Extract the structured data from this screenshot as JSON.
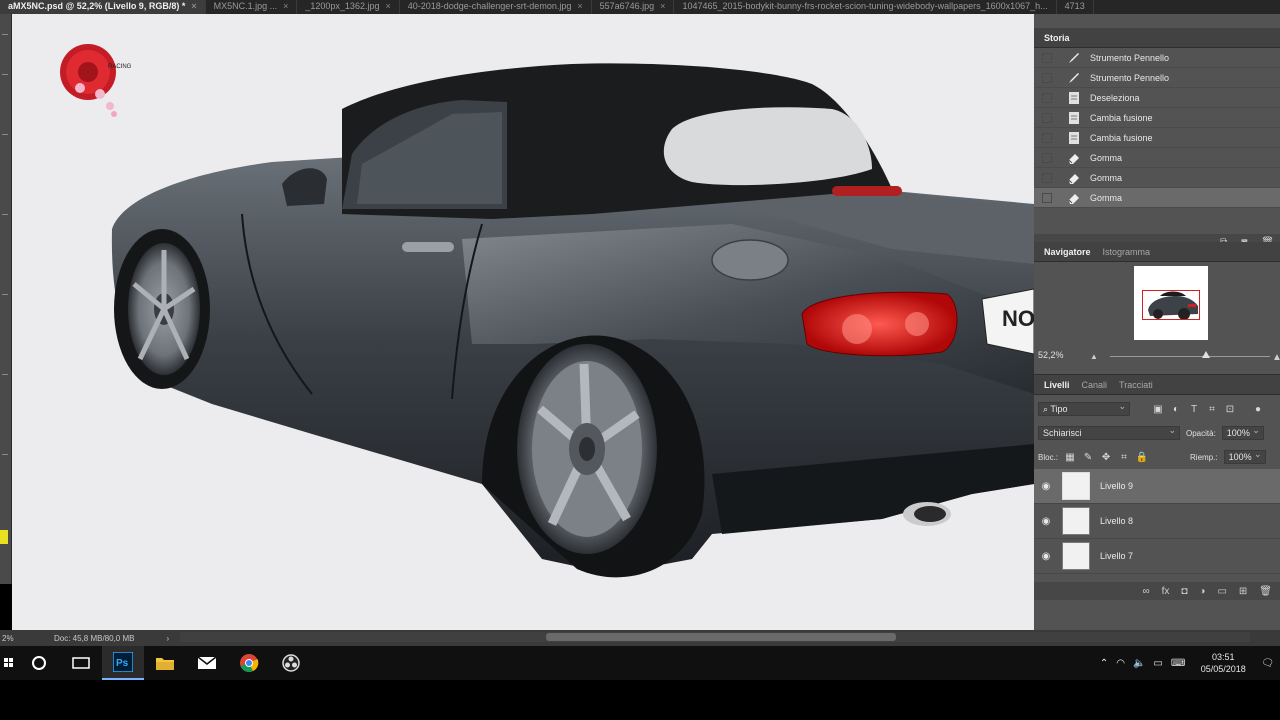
{
  "tabs": [
    {
      "label": "aMX5NC.psd @ 52,2% (Livello 9, RGB/8) *",
      "active": true
    },
    {
      "label": "MX5NC.1.jpg ...",
      "active": false
    },
    {
      "label": "_1200px_1362.jpg",
      "active": false
    },
    {
      "label": "40-2018-dodge-challenger-srt-demon.jpg",
      "active": false
    },
    {
      "label": "557a6746.jpg",
      "active": false
    },
    {
      "label": "1047465_2015-bodykit-bunny-frs-rocket-scion-tuning-widebody-wallpapers_1600x1067_h...",
      "active": false
    },
    {
      "label": "4713",
      "active": false
    }
  ],
  "history": {
    "title": "Storia",
    "items": [
      {
        "label": "Strumento Pennello",
        "icon": "brush-icon",
        "selected": false
      },
      {
        "label": "Strumento Pennello",
        "icon": "brush-icon",
        "selected": false
      },
      {
        "label": "Deseleziona",
        "icon": "document-icon",
        "selected": false
      },
      {
        "label": "Cambia fusione",
        "icon": "document-icon",
        "selected": false
      },
      {
        "label": "Cambia fusione",
        "icon": "document-icon",
        "selected": false
      },
      {
        "label": "Gomma",
        "icon": "eraser-icon",
        "selected": false
      },
      {
        "label": "Gomma",
        "icon": "eraser-icon",
        "selected": false
      },
      {
        "label": "Gomma",
        "icon": "eraser-icon",
        "selected": true
      }
    ]
  },
  "navigator": {
    "tabs": [
      "Navigatore",
      "Istogramma"
    ],
    "zoom": "52,2%",
    "zoom_fraction": 0.6
  },
  "layers": {
    "tabs": [
      "Livelli",
      "Canali",
      "Tracciati"
    ],
    "filter_label": "Tipo",
    "blend_mode": "Schiarisci",
    "opacity_label": "Opacità:",
    "opacity_value": "100%",
    "lock_label": "Bloc.:",
    "fill_label": "Riemp.:",
    "fill_value": "100%",
    "items": [
      {
        "name": "Livello 9",
        "visible": true,
        "selected": true
      },
      {
        "name": "Livello 8",
        "visible": true,
        "selected": false
      },
      {
        "name": "Livello 7",
        "visible": true,
        "selected": false
      }
    ]
  },
  "canvas": {
    "plate_text": "NO",
    "logo_text": "RACING"
  },
  "status": {
    "zoom": "2%",
    "doc_size": "Doc: 45,8 MB/80,0 MB"
  },
  "taskbar": {
    "time": "03:51",
    "date": "05/05/2018"
  },
  "colors": {
    "canvas_bg": "#ececef",
    "panel_bg": "#535353",
    "selected_row": "#6a6a6a",
    "car_body": "#3d4248",
    "tail_light": "#e02020"
  }
}
